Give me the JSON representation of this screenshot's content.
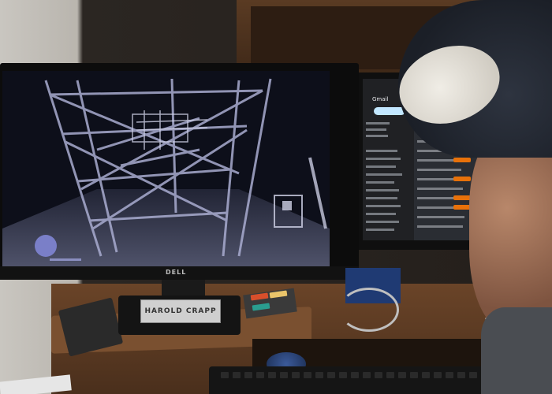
{
  "monitor": {
    "brand": "DELL"
  },
  "nameplate": {
    "text": "HAROLD CRAPP"
  },
  "email": {
    "app_title": "Gmail"
  },
  "colors": {
    "point_cloud": "#9aa0c8",
    "screen_bg": "#0d0f1a",
    "cap_brim": "#e8e3da",
    "cap_crown": "#1e232c",
    "desk": "#5a3a22"
  }
}
